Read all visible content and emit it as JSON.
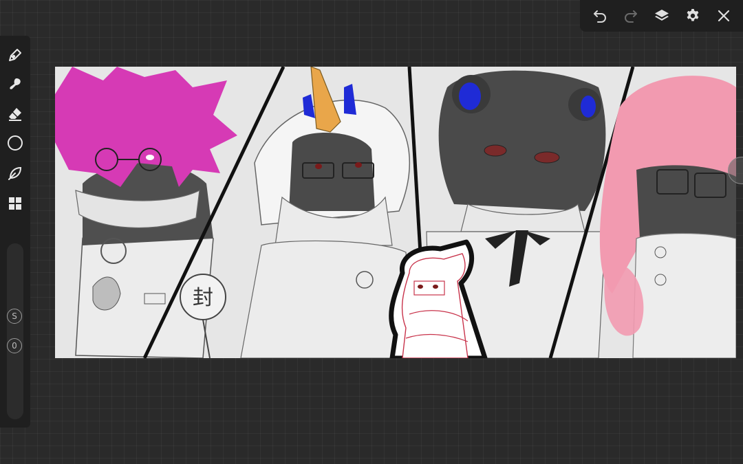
{
  "toolbar": {
    "buttons": [
      {
        "name": "undo",
        "icon": "undo-icon"
      },
      {
        "name": "redo",
        "icon": "redo-icon"
      },
      {
        "name": "layers",
        "icon": "layers-icon"
      },
      {
        "name": "settings",
        "icon": "gear-icon"
      },
      {
        "name": "close",
        "icon": "close-icon"
      }
    ]
  },
  "sidebar": {
    "tools": [
      {
        "name": "pen",
        "icon": "pen-icon"
      },
      {
        "name": "smudge",
        "icon": "smudge-icon"
      },
      {
        "name": "eraser",
        "icon": "eraser-icon"
      },
      {
        "name": "color",
        "icon": "color-circle-icon"
      },
      {
        "name": "leaf-brush",
        "icon": "leaf-icon"
      },
      {
        "name": "apps",
        "icon": "grid-icon"
      }
    ],
    "size_badge": "S",
    "opacity_badge": "0"
  },
  "canvas": {
    "sign_text": "封",
    "colors": {
      "magenta_hair": "#d63ab5",
      "pink_hair": "#f29ab0",
      "blue_ears": "#1f2bd6",
      "horn": "#e9a64a",
      "dark_hair": "#4a4a4a",
      "chibi_line": "#c8324a"
    }
  }
}
